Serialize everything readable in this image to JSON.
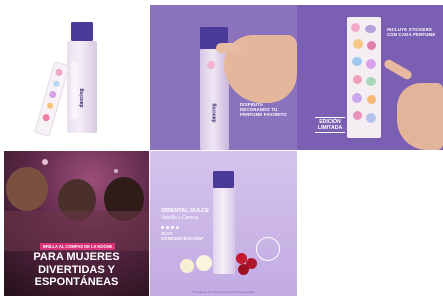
{
  "tile1": {
    "bottle_label": "dancing",
    "sticker_brand": "dancing"
  },
  "tile2": {
    "bottle_label": "dancing",
    "caption": [
      "DISFRUTA",
      "DECORANDO TU",
      "PERFUME FAVORITO"
    ]
  },
  "tile3": {
    "caption": [
      "INCLUYE STICKERS",
      "CON CADA PERFUME"
    ],
    "badge": [
      "EDICIÓN",
      "LIMITADA"
    ]
  },
  "tile4": {
    "tag": "BRILLA AL COMPAS DE LA NOCHE",
    "headline": [
      "PARA MUJERES",
      "DIVERTIDAS Y",
      "ESPONTÁNEAS"
    ]
  },
  "tile5": {
    "title": "ORIENTAL DULCE",
    "subtitle": "Vainilla y Cereza",
    "concentration": [
      "ALTA",
      "CONCENTRACIÓN*"
    ],
    "footnote": "*Fragancia con alta concentración de esencias"
  },
  "colors": {
    "purple_bg": "#8a72bd",
    "cap_indigo": "#4a3b98",
    "tag_pink": "#d8327a"
  }
}
